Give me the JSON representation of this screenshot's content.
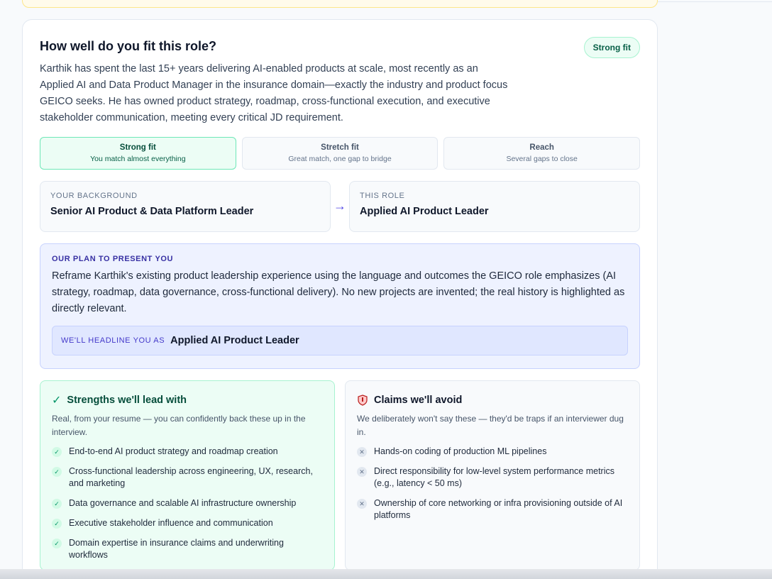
{
  "fit": {
    "title": "How well do you fit this role?",
    "badge": "Strong fit",
    "summary": "Karthik has spent the last 15+ years delivering AI-enabled products at scale, most recently as an Applied AI and Data Product Manager in the insurance domain—exactly the industry and product focus GEICO seeks. He has owned product strategy, roadmap, cross-functional execution, and executive stakeholder communication, meeting every critical JD requirement.",
    "tiers": [
      {
        "label": "Strong fit",
        "desc": "You match almost everything"
      },
      {
        "label": "Stretch fit",
        "desc": "Great match, one gap to bridge"
      },
      {
        "label": "Reach",
        "desc": "Several gaps to close"
      }
    ]
  },
  "background": {
    "label": "YOUR BACKGROUND",
    "value": "Senior AI Product & Data Platform Leader"
  },
  "role": {
    "label": "THIS ROLE",
    "value": "Applied AI Product Leader"
  },
  "plan": {
    "heading": "OUR PLAN TO PRESENT YOU",
    "text": "Reframe Karthik's existing product leadership experience using the language and outcomes the GEICO role emphasizes (AI strategy, roadmap, data governance, cross-functional delivery). No new projects are invented; the real history is highlighted as directly relevant.",
    "headline_label": "WE'LL HEADLINE YOU AS",
    "headline_value": "Applied AI Product Leader"
  },
  "strengths": {
    "title": "Strengths we'll lead with",
    "subtitle": "Real, from your resume — you can confidently back these up in the interview.",
    "items": [
      "End-to-end AI product strategy and roadmap creation",
      "Cross-functional leadership across engineering, UX, research, and marketing",
      "Data governance and scalable AI infrastructure ownership",
      "Executive stakeholder influence and communication",
      "Domain expertise in insurance claims and underwriting workflows"
    ]
  },
  "avoid": {
    "title": "Claims we'll avoid",
    "subtitle": "We deliberately won't say these — they'd be traps if an interviewer dug in.",
    "items": [
      "Hands-on coding of production ML pipelines",
      "Direct responsibility for low-level system performance metrics (e.g., latency < 50 ms)",
      "Ownership of core networking or infra provisioning outside of AI platforms"
    ]
  },
  "icons": {
    "arrow": "arrow-right-icon",
    "check": "check-icon",
    "shield": "shield-icon",
    "x": "x-icon"
  },
  "colors": {
    "accent": "#4f46e5",
    "success": "#059669",
    "success_bg": "#ecfdf5"
  }
}
